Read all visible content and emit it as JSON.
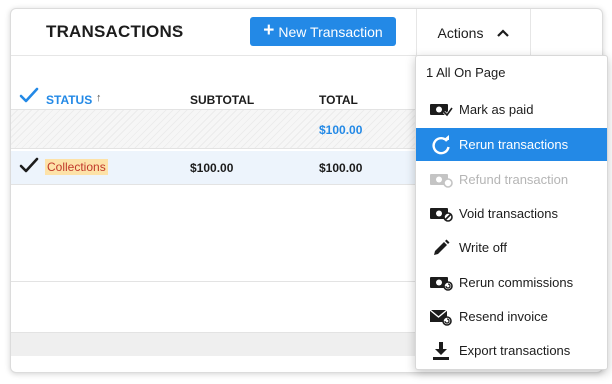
{
  "header": {
    "title": "TRANSACTIONS",
    "new_button": "New Transaction",
    "actions_label": "Actions"
  },
  "table": {
    "columns": {
      "status": "STATUS",
      "subtotal": "SUBTOTAL",
      "total": "TOTAL"
    },
    "summary_total": "$100.00",
    "rows": [
      {
        "status": "Collections",
        "subtotal": "$100.00",
        "total": "$100.00",
        "checked": true
      }
    ]
  },
  "menu": {
    "header": "1 All On Page",
    "items": [
      {
        "label": "Mark as paid",
        "icon": "cash-check-icon",
        "state": "normal"
      },
      {
        "label": "Rerun transactions",
        "icon": "refresh-icon",
        "state": "active"
      },
      {
        "label": "Refund transaction",
        "icon": "cash-refund-icon",
        "state": "disabled"
      },
      {
        "label": "Void transactions",
        "icon": "cash-void-icon",
        "state": "normal"
      },
      {
        "label": "Write off",
        "icon": "pencil-icon",
        "state": "normal"
      },
      {
        "label": "Rerun commissions",
        "icon": "cash-rerun-icon",
        "state": "normal"
      },
      {
        "label": "Resend invoice",
        "icon": "envelope-resend-icon",
        "state": "normal"
      },
      {
        "label": "Export transactions",
        "icon": "download-icon",
        "state": "normal"
      }
    ]
  },
  "colors": {
    "accent": "#2389e6",
    "row_highlight": "#edf4fc",
    "badge_bg": "#fde2a8",
    "badge_text": "#c0392b"
  }
}
